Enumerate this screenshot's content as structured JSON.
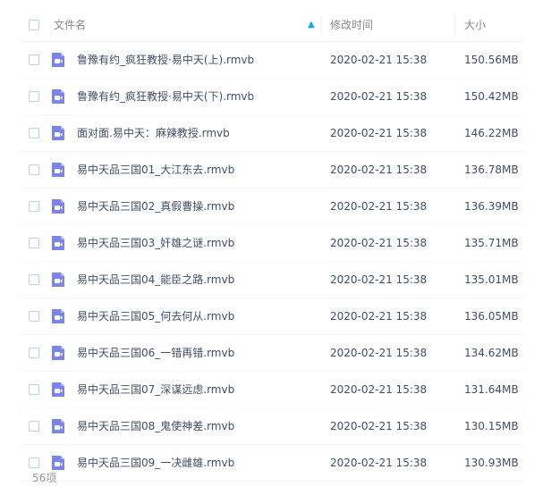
{
  "header": {
    "name_label": "文件名",
    "mtime_label": "修改时间",
    "size_label": "大小",
    "sort_icon": "sort-ascending-arrow"
  },
  "files": [
    {
      "name": "鲁豫有约_疯狂教授·易中天(上).rmvb",
      "mtime": "2020-02-21 15:38",
      "size": "150.56MB"
    },
    {
      "name": "鲁豫有约_疯狂教授·易中天(下).rmvb",
      "mtime": "2020-02-21 15:38",
      "size": "150.42MB"
    },
    {
      "name": "面对面.易中天：麻辣教授.rmvb",
      "mtime": "2020-02-21 15:38",
      "size": "146.22MB"
    },
    {
      "name": "易中天品三国01_大江东去.rmvb",
      "mtime": "2020-02-21 15:38",
      "size": "136.78MB"
    },
    {
      "name": "易中天品三国02_真假曹操.rmvb",
      "mtime": "2020-02-21 15:38",
      "size": "136.39MB"
    },
    {
      "name": "易中天品三国03_奸雄之谜.rmvb",
      "mtime": "2020-02-21 15:38",
      "size": "135.71MB"
    },
    {
      "name": "易中天品三国04_能臣之路.rmvb",
      "mtime": "2020-02-21 15:38",
      "size": "135.01MB"
    },
    {
      "name": "易中天品三国05_何去何从.rmvb",
      "mtime": "2020-02-21 15:38",
      "size": "136.05MB"
    },
    {
      "name": "易中天品三国06_一错再错.rmvb",
      "mtime": "2020-02-21 15:38",
      "size": "134.62MB"
    },
    {
      "name": "易中天品三国07_深谋远虑.rmvb",
      "mtime": "2020-02-21 15:38",
      "size": "131.64MB"
    },
    {
      "name": "易中天品三国08_鬼使神差.rmvb",
      "mtime": "2020-02-21 15:38",
      "size": "130.15MB"
    },
    {
      "name": "易中天品三国09_一决雌雄.rmvb",
      "mtime": "2020-02-21 15:38",
      "size": "130.93MB"
    }
  ],
  "file_icon": "video-file-icon",
  "footer": {
    "count": "56项"
  },
  "colors": {
    "icon_purple": "#7b84e8",
    "sort_arrow": "#09aaff",
    "text": "#424e67",
    "muted": "#888888"
  }
}
